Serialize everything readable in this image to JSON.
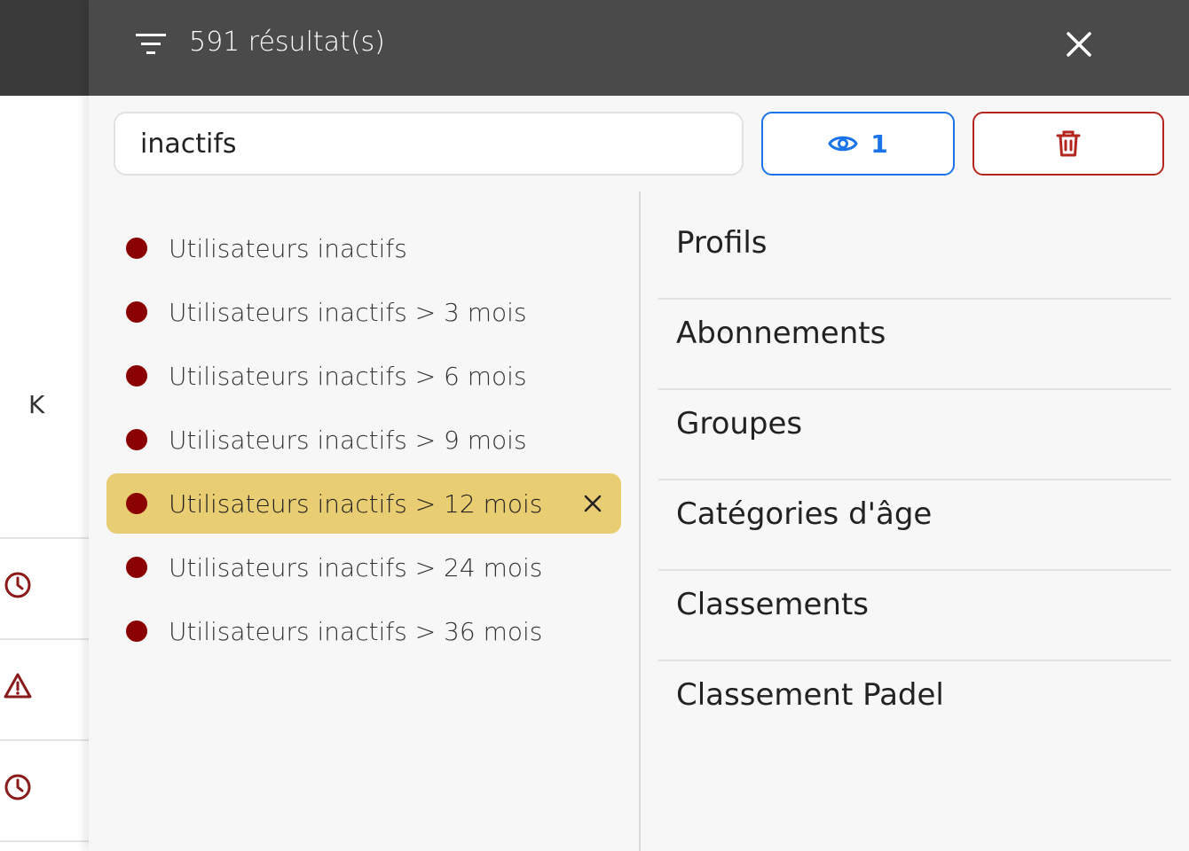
{
  "background": {
    "letter": "K"
  },
  "header": {
    "result_count": "591 résultat(s)"
  },
  "search": {
    "value": "inactifs"
  },
  "view_button": {
    "count": "1"
  },
  "filters": [
    {
      "label": "Utilisateurs inactifs",
      "selected": false
    },
    {
      "label": "Utilisateurs inactifs > 3 mois",
      "selected": false
    },
    {
      "label": "Utilisateurs inactifs > 6 mois",
      "selected": false
    },
    {
      "label": "Utilisateurs inactifs > 9 mois",
      "selected": false
    },
    {
      "label": "Utilisateurs inactifs > 12 mois",
      "selected": true
    },
    {
      "label": "Utilisateurs inactifs > 24 mois",
      "selected": false
    },
    {
      "label": "Utilisateurs inactifs > 36 mois",
      "selected": false
    }
  ],
  "categories": [
    {
      "label": "Profils"
    },
    {
      "label": "Abonnements"
    },
    {
      "label": "Groupes"
    },
    {
      "label": "Catégories d'âge"
    },
    {
      "label": "Classements"
    },
    {
      "label": "Classement Padel"
    }
  ],
  "colors": {
    "header_bg": "#4a4a4a",
    "selected_bg": "#e9cd72",
    "dot": "#8b0000",
    "view_accent": "#1a73e8",
    "delete_accent": "#b3261e"
  }
}
